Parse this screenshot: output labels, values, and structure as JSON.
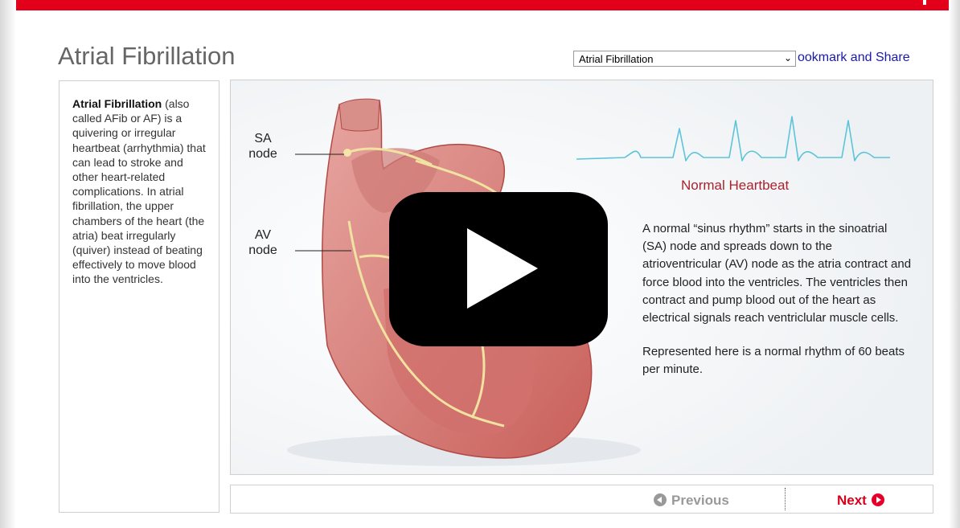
{
  "header": {
    "title": "Atrial Fibrillation"
  },
  "topic_select": {
    "selected": "Atrial Fibrillation"
  },
  "share_link": {
    "label": "ookmark and Share"
  },
  "sidebar": {
    "term": "Atrial Fibrillation",
    "description": " (also called AFib or AF) is a quivering or irregular heartbeat (arrhythmia) that can lead to stroke and other heart-related complications. In atrial fibrillation, the upper chambers of the heart (the atria) beat irregularly (quiver) instead of beating effectively to move blood into the ventricles."
  },
  "illustration": {
    "sa_label": "SA node",
    "av_label": "AV node",
    "ekg_title": "Normal Heartbeat",
    "paragraph_1": "A normal “sinus rhythm” starts in the sinoatrial (SA) node and spreads down to the atrioventricular (AV) node as the atria contract and force blood into the ventricles. The ventricles then contract and pump blood out of the heart as electrical signals reach ventriclular muscle cells.",
    "paragraph_2": "Represented here is a normal rhythm of 60 beats per minute.",
    "colors": {
      "ekg": "#5cc4d8",
      "title": "#a8232e"
    }
  },
  "navigation": {
    "previous_label": "Previous",
    "next_label": "Next"
  },
  "colors": {
    "brand_red": "#e3001b",
    "link_blue": "#1a1aa6"
  }
}
